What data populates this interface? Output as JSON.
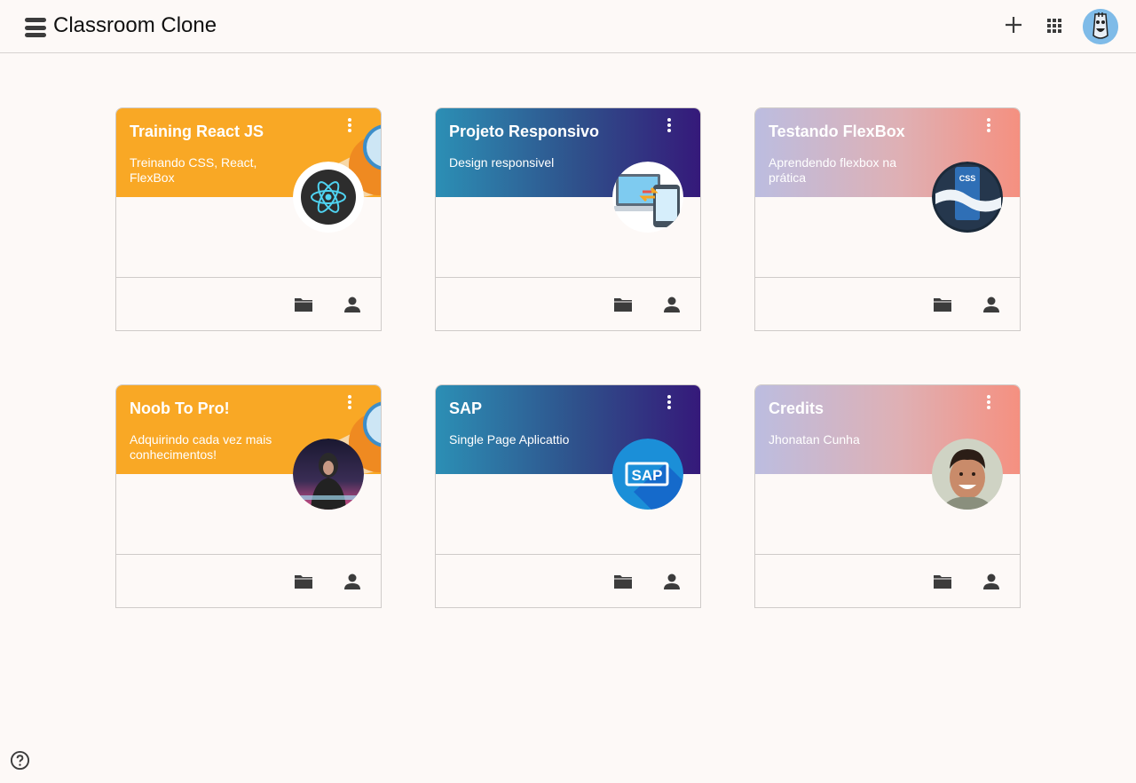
{
  "header": {
    "title": "Classroom Clone",
    "menu_icon": "hamburger-icon",
    "add_icon": "plus-icon",
    "apps_icon": "grid-icon",
    "avatar_icon": "user-avatar"
  },
  "cards": [
    {
      "title": "Training React JS",
      "subtitle": "Treinando CSS, React, FlexBox",
      "theme": "orange",
      "avatar": "react-logo-icon"
    },
    {
      "title": "Projeto Responsivo",
      "subtitle": "Design responsivel",
      "theme": "blue",
      "avatar": "responsive-devices-icon"
    },
    {
      "title": "Testando FlexBox",
      "subtitle": "Aprendendo flexbox na prática",
      "theme": "pink",
      "avatar": "css-logo-icon"
    },
    {
      "title": "Noob To Pro!",
      "subtitle": "Adquirindo cada vez mais conhecimentos!",
      "theme": "orange",
      "avatar": "hooded-person-photo"
    },
    {
      "title": "SAP",
      "subtitle": "Single Page Aplicattio",
      "theme": "blue",
      "avatar": "sap-logo-icon"
    },
    {
      "title": "Credits",
      "subtitle": "Jhonatan Cunha",
      "theme": "pink",
      "avatar": "smiling-person-photo"
    }
  ],
  "card_footer_icons": [
    "folder-icon",
    "person-icon"
  ],
  "colors": {
    "background": "#fdf9f7",
    "orange": "#f9a825",
    "blue_start": "#2c8fb5",
    "blue_end": "#35197a",
    "pink_start": "#bcbde0",
    "pink_end": "#f59080",
    "icon": "#3c3c3c"
  },
  "help_icon": "help-circle-icon"
}
